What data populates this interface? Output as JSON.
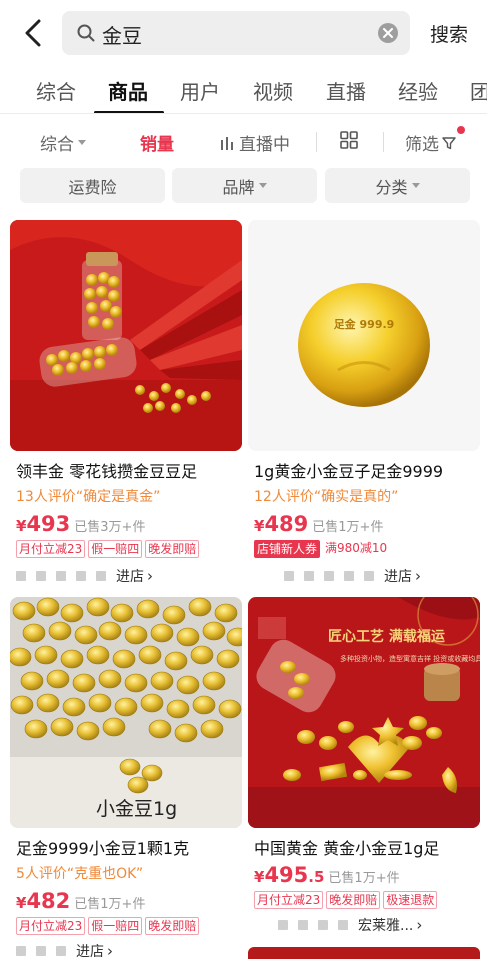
{
  "search": {
    "query": "金豆",
    "button_label": "搜索"
  },
  "tabs": [
    {
      "label": "综合",
      "active": false
    },
    {
      "label": "商品",
      "active": true
    },
    {
      "label": "用户",
      "active": false
    },
    {
      "label": "视频",
      "active": false
    },
    {
      "label": "直播",
      "active": false
    },
    {
      "label": "经验",
      "active": false
    },
    {
      "label": "团",
      "active": false
    }
  ],
  "sortbar": {
    "comprehensive": "综合",
    "sales": "销量",
    "live": "直播中",
    "filter": "筛选"
  },
  "chips": [
    "运费险",
    "品牌",
    "分类"
  ],
  "colors": {
    "accent": "#e8364f",
    "review": "#ef8a3b",
    "chip_bg": "#f1f1f1"
  },
  "products": [
    {
      "title": "领丰金 零花钱攒金豆豆足",
      "review": "13人评价“确定是真金”",
      "price_int": "493",
      "price_dec": "",
      "sold": "已售3万+件",
      "tags": [
        "月付立减23",
        "假一赔四",
        "晚发即赔"
      ],
      "store": "进店"
    },
    {
      "title": "1g黄金小金豆子足金9999",
      "review": "12人评价“确实是真的”",
      "price_int": "489",
      "price_dec": "",
      "sold": "已售1万+件",
      "tags": [
        "店铺新人券",
        "满980减10"
      ],
      "store": "进店"
    },
    {
      "title": "足金9999小金豆1颗1克",
      "review": "5人评价“克重也OK”",
      "price_int": "482",
      "price_dec": "",
      "sold": "已售1万+件",
      "tags": [
        "月付立减23",
        "假一赔四",
        "晚发即赔"
      ],
      "store": "进店",
      "image_caption": "小金豆1g"
    },
    {
      "title": "中国黄金 黄金小金豆1g足",
      "review": "",
      "price_int": "495",
      "price_dec": ".5",
      "sold": "已售1万+件",
      "tags": [
        "月付立减23",
        "晚发即赔",
        "极速退款"
      ],
      "store": "宏莱雅...",
      "image_banner": "匠心工艺 满载福运",
      "image_subtext": "多种投资小物，造型寓意吉祥 投资或收藏均具价值"
    }
  ],
  "currency": "¥",
  "gold_label": "足金 999.9"
}
